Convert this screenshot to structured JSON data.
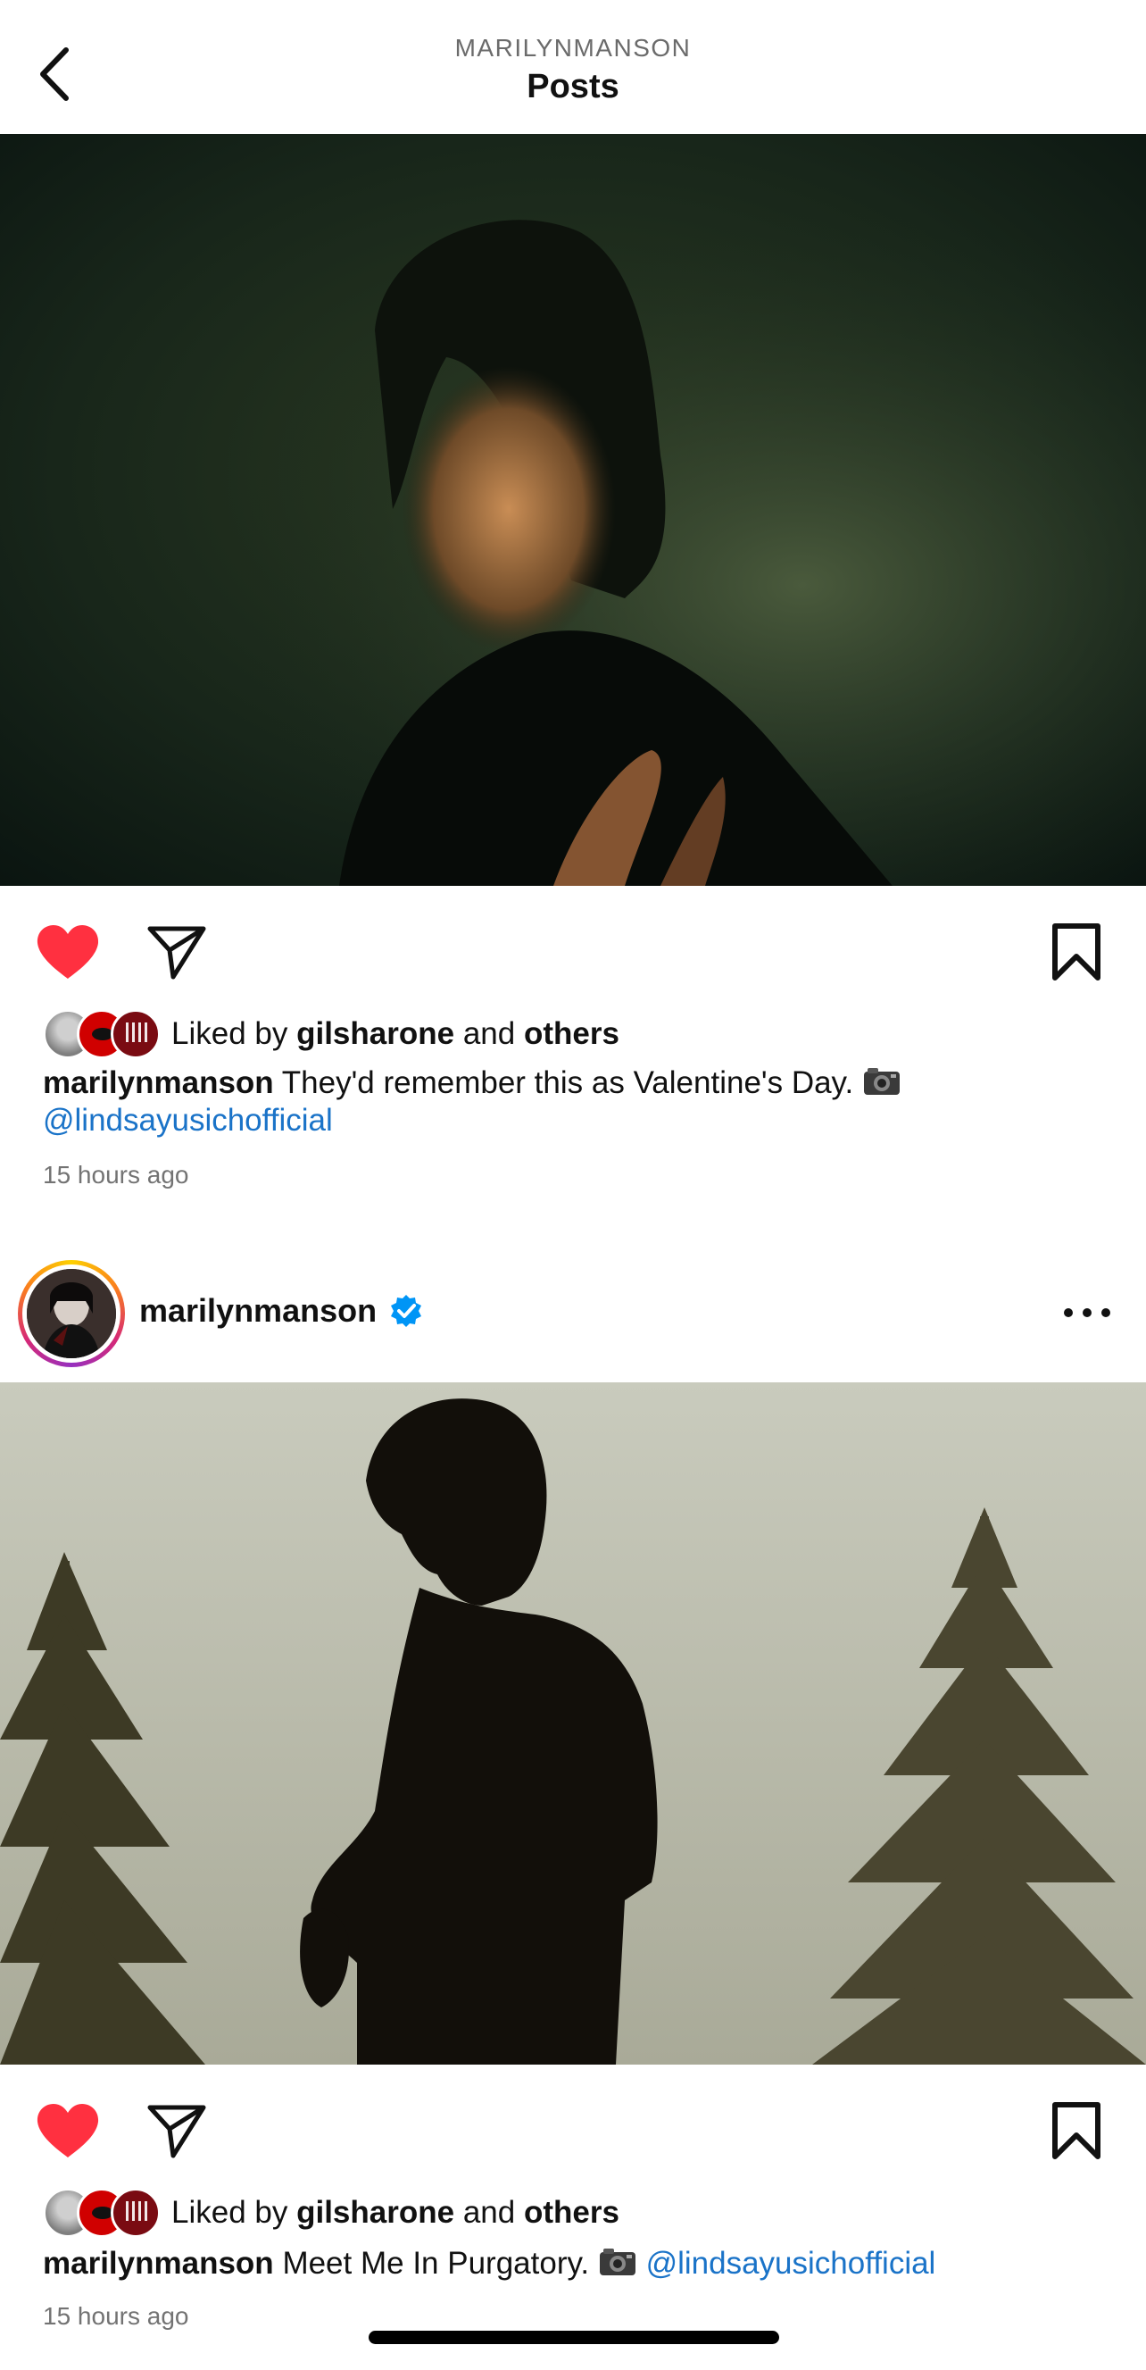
{
  "header": {
    "subtitle": "MARILYNMANSON",
    "title": "Posts",
    "back_icon": "chevron-left-icon"
  },
  "posts": [
    {
      "liked_by_prefix": "Liked by",
      "liked_by_user": "gilsharone",
      "liked_by_and": "and",
      "liked_by_others": "others",
      "caption_user": "marilynmanson",
      "caption_text": "They'd remember this as Valentine's Day.",
      "caption_mention": "@lindsayusichofficial",
      "time": "15 hours ago",
      "liked": true
    },
    {
      "author": "marilynmanson",
      "verified": true,
      "liked_by_prefix": "Liked by",
      "liked_by_user": "gilsharone",
      "liked_by_and": "and",
      "liked_by_others": "others",
      "caption_user": "marilynmanson",
      "caption_text": "Meet Me In Purgatory.",
      "caption_mention": "@lindsayusichofficial",
      "time": "15 hours ago",
      "liked": true
    }
  ],
  "colors": {
    "like_red": "#ff3040",
    "mention_blue": "#1a73c8",
    "verified_blue": "#0095f6"
  }
}
